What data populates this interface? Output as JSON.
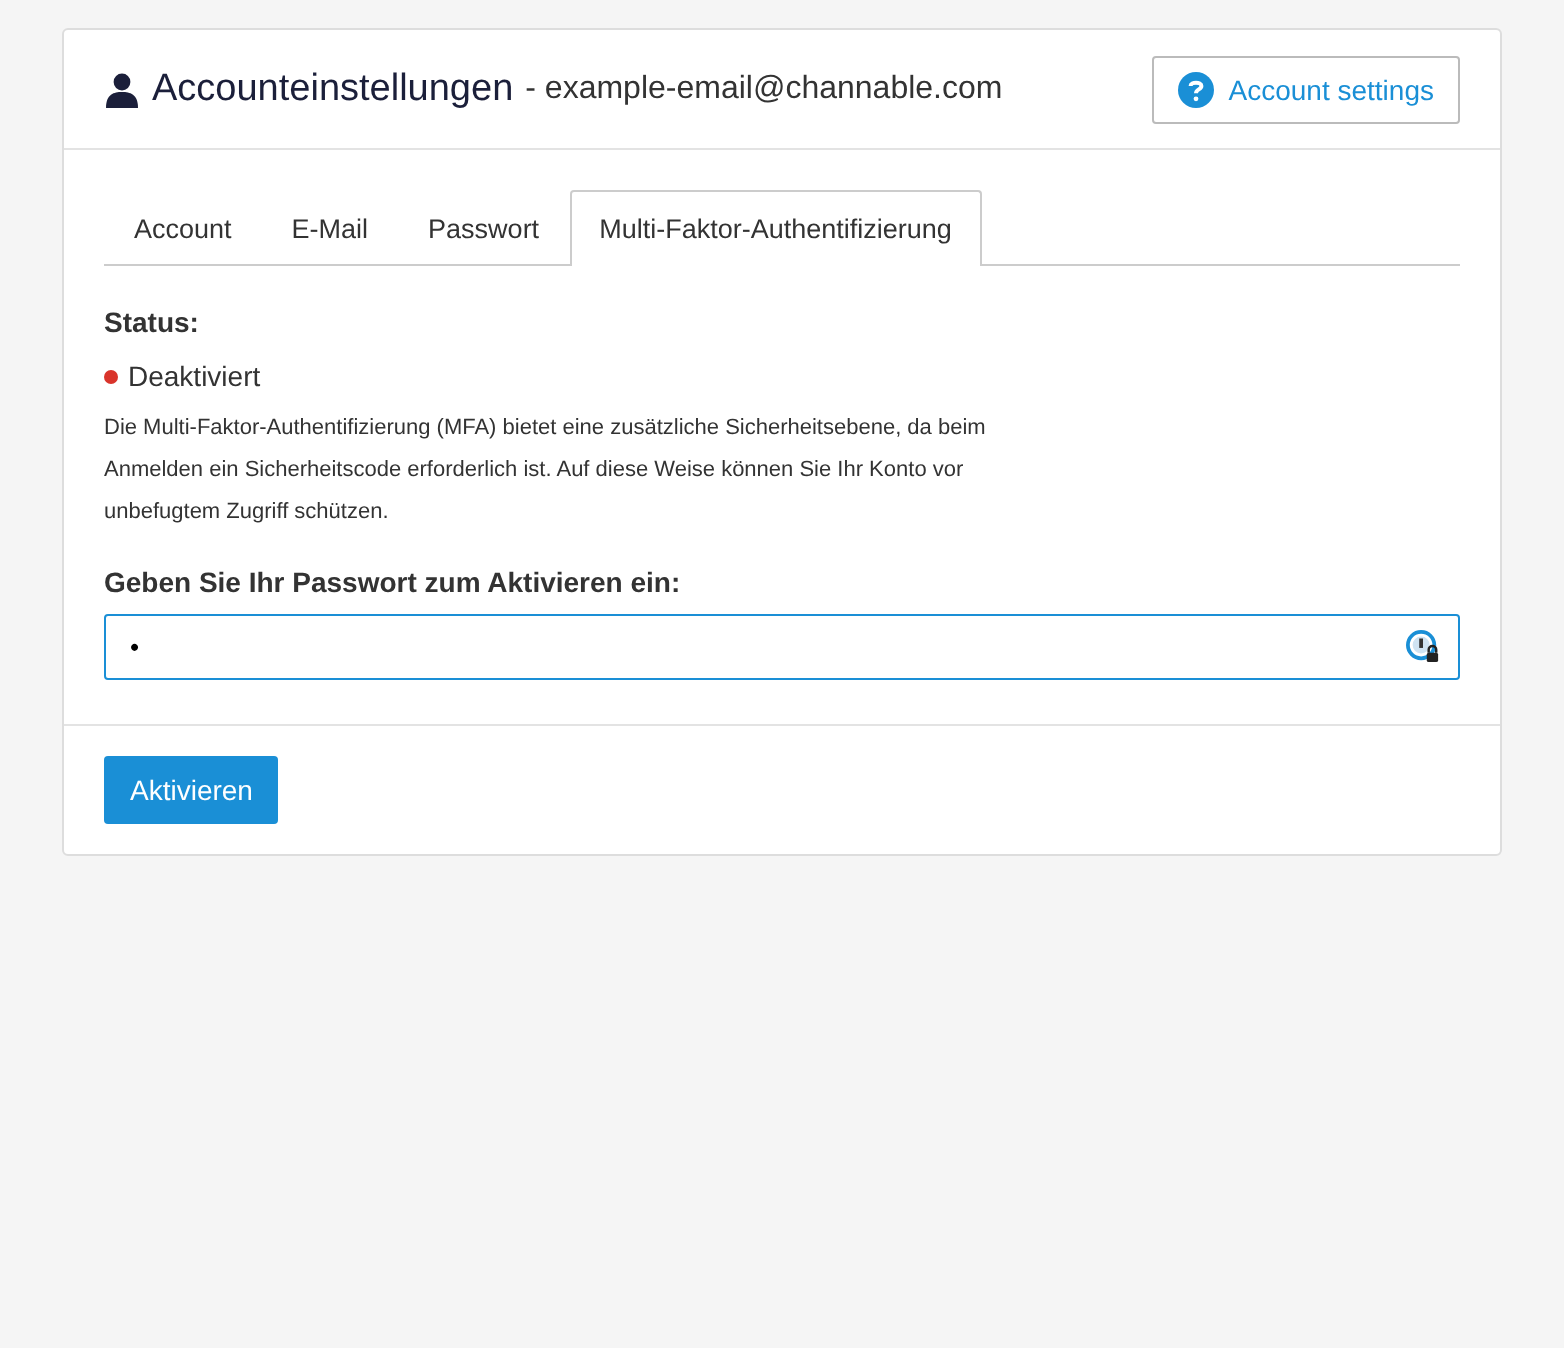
{
  "header": {
    "title": "Accounteinstellungen",
    "subtitle": "- example-email@channable.com",
    "help_button": "Account settings"
  },
  "tabs": [
    {
      "label": "Account",
      "selected": false
    },
    {
      "label": "E-Mail",
      "selected": false
    },
    {
      "label": "Passwort",
      "selected": false
    },
    {
      "label": "Multi-Faktor-Authentifizierung",
      "selected": true
    }
  ],
  "status": {
    "label": "Status:",
    "value": "Deaktiviert",
    "color": "#d9342b"
  },
  "description": "Die Multi-Faktor-Authentifizierung (MFA) bietet eine zusätzliche Sicherheitsebene, da beim Anmelden ein Sicherheitscode erforderlich ist. Auf diese Weise können Sie Ihr Konto vor unbefugtem Zugriff schützen.",
  "password": {
    "label": "Geben Sie Ihr Passwort zum Aktivieren ein:",
    "value": "•"
  },
  "submit_button": "Aktivieren"
}
